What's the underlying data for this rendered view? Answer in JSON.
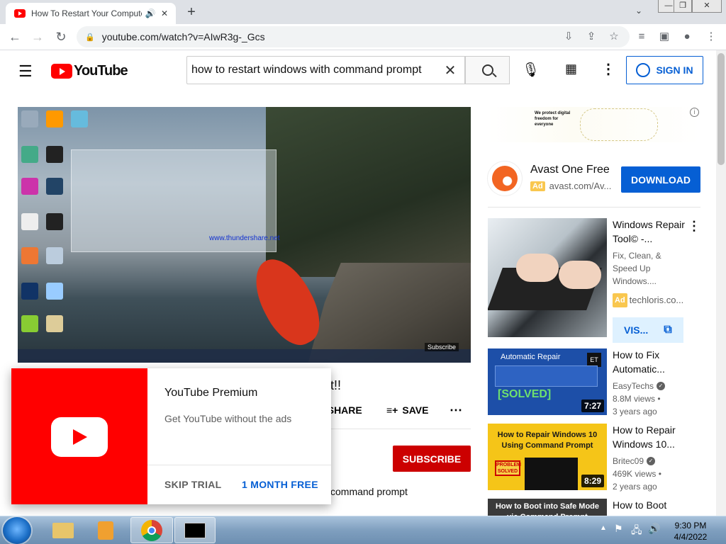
{
  "browser": {
    "tab_title": "How To Restart Your Computer Using Command Prompt",
    "url": "youtube.com/watch?v=AIwR3g-_Gcs",
    "new_tab_label": "+",
    "window_controls": [
      "minimize",
      "restore",
      "close"
    ]
  },
  "youtube": {
    "logo_text": "YouTube",
    "search_value": "how to restart windows with command prompt",
    "sign_in_label": "SIGN IN"
  },
  "video": {
    "watermark": "www.thundershare.net",
    "subscribe_overlay": "Subscribe",
    "title_fragment": "t!!",
    "share_label": "SHARE",
    "save_label": "SAVE",
    "subscribe_label": "SUBSCRIBE",
    "description_fragment": "command prompt"
  },
  "premium_promo": {
    "title": "YouTube Premium",
    "description": "Get YouTube without the ads",
    "skip_label": "SKIP TRIAL",
    "trial_label": "1 MONTH FREE"
  },
  "sidebar": {
    "banner_text": "We protect digital freedom for everyone",
    "ad": {
      "title": "Avast One Free",
      "badge": "Ad",
      "url": "avast.com/Av...",
      "button": "DOWNLOAD"
    },
    "videos": [
      {
        "title": "Windows Repair Tool© -...",
        "meta1": "Fix, Clean, &",
        "meta2": "Speed Up",
        "meta3": "Windows....",
        "badge": "Ad",
        "channel": "techloris.co...",
        "action": "VIS..."
      },
      {
        "title": "How to Fix Automatic...",
        "thumb_label": "Automatic Repair",
        "thumb_stamp": "[SOLVED]",
        "channel": "EasyTechs",
        "views": "8.8M views •",
        "age": "3 years ago",
        "duration": "7:27"
      },
      {
        "title": "How to Repair Windows 10...",
        "thumb_label": "How to Repair Windows 10 Using Command Prompt",
        "thumb_stamp": "PROBLEM SOLVED",
        "channel": "Britec09",
        "views": "469K views •",
        "age": "2 years ago",
        "duration": "8:29"
      },
      {
        "title": "How to Boot",
        "thumb_label": "How to Boot into Safe Mode via Command Prompt"
      }
    ]
  },
  "taskbar": {
    "time": "9:30 PM",
    "date": "4/4/2022",
    "tray_arrow": "▲"
  }
}
